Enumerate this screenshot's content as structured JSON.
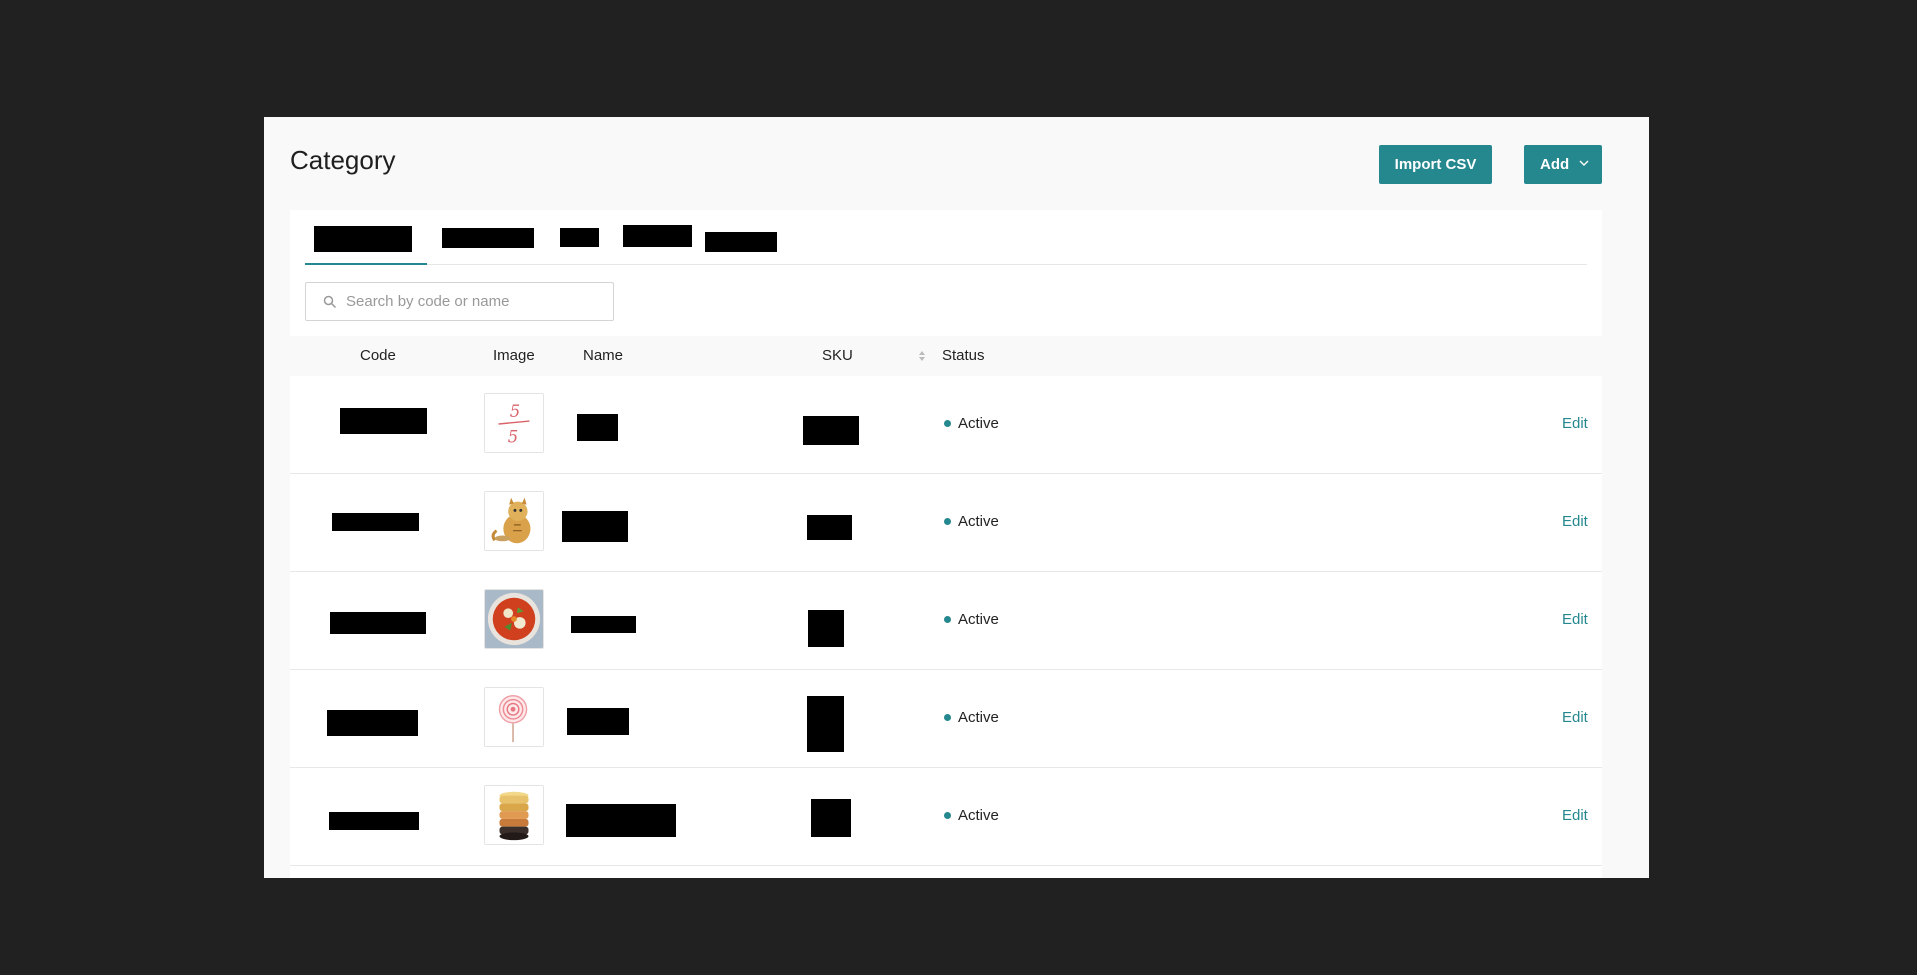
{
  "page": {
    "title": "Category",
    "import_label": "Import CSV",
    "add_label": "Add"
  },
  "search": {
    "placeholder": "Search by code or name"
  },
  "table": {
    "headers": {
      "code": "Code",
      "image": "Image",
      "name": "Name",
      "sku": "SKU",
      "status": "Status"
    },
    "rows": [
      {
        "image": "handwritten-five-fraction",
        "status": "Active",
        "action": "Edit"
      },
      {
        "image": "cat-figurine",
        "status": "Active",
        "action": "Edit"
      },
      {
        "image": "soup-bowl",
        "status": "Active",
        "action": "Edit"
      },
      {
        "image": "lollipop",
        "status": "Active",
        "action": "Edit"
      },
      {
        "image": "stacked-macarons",
        "status": "Active",
        "action": "Edit"
      }
    ]
  },
  "colors": {
    "accent": "#25888f",
    "background": "#212121",
    "panel": "#f9f9f9"
  }
}
